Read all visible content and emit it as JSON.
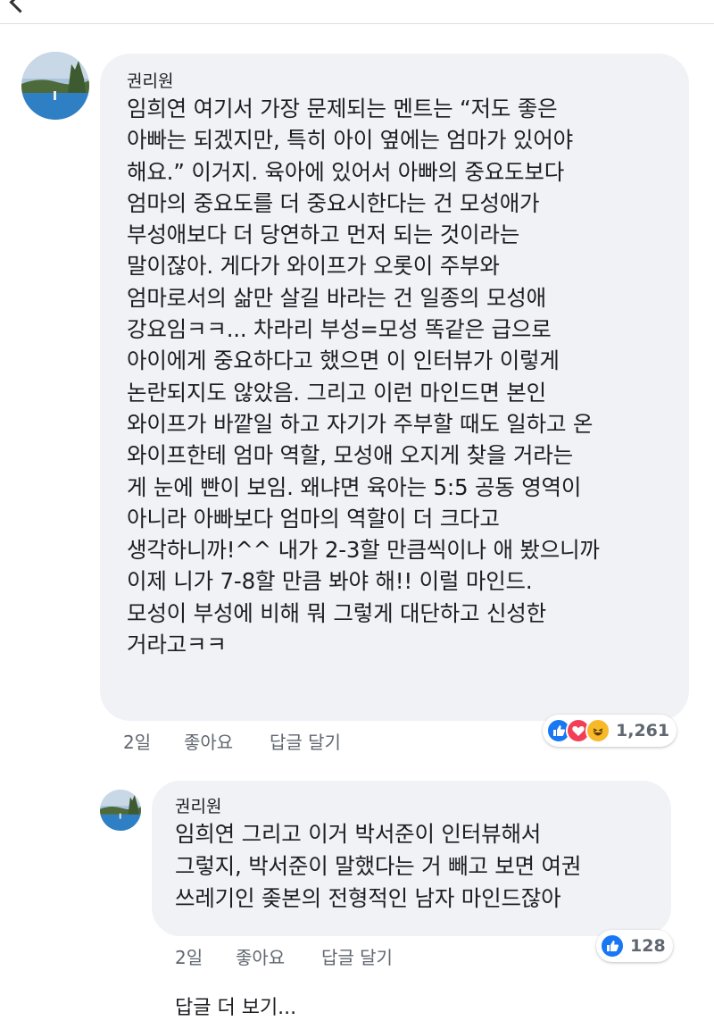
{
  "comments": [
    {
      "author": "권리원",
      "text": "임희연 여기서 가장 문제되는 멘트는 “저도 좋은\n아빠는 되겠지만, 특히 아이 옆에는 엄마가 있어야\n해요.” 이거지. 육아에 있어서 아빠의 중요도보다\n엄마의 중요도를 더 중요시한다는 건 모성애가\n부성애보다 더 당연하고 먼저 되는 것이라는\n말이잖아. 게다가 와이프가 오롯이 주부와\n엄마로서의 삶만 살길 바라는 건 일종의 모성애\n강요임ㅋㅋ... 차라리 부성=모성 똑같은 급으로\n아이에게 중요하다고 했으면 이 인터뷰가 이렇게\n논란되지도 않았음. 그리고 이런 마인드면 본인\n와이프가 바깥일 하고 자기가 주부할 때도 일하고 온\n와이프한테 엄마 역할, 모성애 오지게 찾을 거라는\n게 눈에 빤이 보임. 왜냐면 육아는 5:5 공동 영역이\n아니라 아빠보다 엄마의 역할이 더 크다고\n생각하니까!^^ 내가 2-3할 만큼씩이나 애 봤으니까\n이제 니가 7-8할 만큼 봐야 해!! 이럴 마인드.\n모성이 부성에 비해 뭐 그렇게 대단하고 신성한\n거라고ㅋㅋ",
      "time": "2일",
      "like_label": "좋아요",
      "reply_label": "답글 달기",
      "reaction_count": "1,261",
      "reaction_icons": [
        "like-icon",
        "love-icon",
        "haha-icon"
      ]
    },
    {
      "author": "권리원",
      "text": "임희연 그리고 이거 박서준이 인터뷰해서\n그렇지, 박서준이 말했다는 거 빼고 보면 여권\n쓰레기인 좆본의 전형적인 남자 마인드잖아",
      "time": "2일",
      "like_label": "좋아요",
      "reply_label": "답글 달기",
      "reaction_count": "128",
      "reaction_icons": [
        "like-icon"
      ]
    }
  ],
  "more_replies_label": "답글 더 보기...",
  "colors": {
    "bubble": "#f0f2f5",
    "like": "#1877f2",
    "love": "#f33e58",
    "haha": "#f7b928",
    "meta_text": "#606770"
  }
}
